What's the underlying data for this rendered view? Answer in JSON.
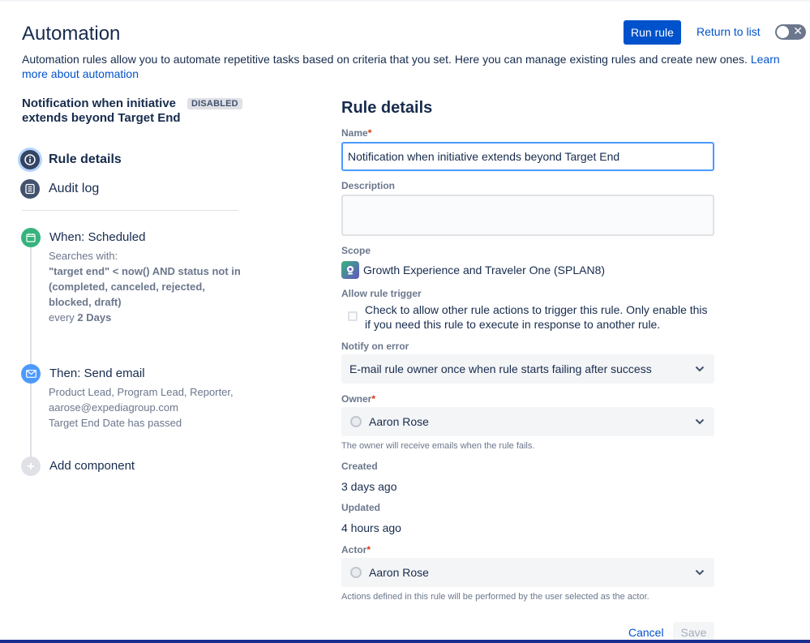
{
  "header": {
    "title": "Automation",
    "run_rule": "Run rule",
    "return_to_list": "Return to list",
    "intro_text": "Automation rules allow you to automate repetitive tasks based on criteria that you set. Here you can manage existing rules and create new ones. ",
    "learn_more": "Learn more about automation"
  },
  "sidebar": {
    "rule_name": "Notification when initiative extends beyond Target End",
    "status_badge": "DISABLED",
    "nav": [
      {
        "label": "Rule details",
        "icon": "info-icon",
        "active": true
      },
      {
        "label": "Audit log",
        "icon": "list-icon",
        "active": false
      }
    ],
    "trigger": {
      "title": "When: Scheduled",
      "searches_label": "Searches with:",
      "jql": "\"target end\" < now() AND status not in (completed, canceled, rejected, blocked, draft)",
      "every_prefix": "every ",
      "every_value": "2 Days",
      "color": "#36b37e"
    },
    "action": {
      "title": "Then: Send email",
      "recipients": "Product Lead, Program Lead, Reporter, aarose@expediagroup.com",
      "subject": "Target End Date has passed",
      "color": "#4c9aff"
    },
    "add_component": "Add component"
  },
  "details": {
    "title": "Rule details",
    "name_label": "Name",
    "name_value": "Notification when initiative extends beyond Target End",
    "description_label": "Description",
    "description_value": "",
    "scope_label": "Scope",
    "scope_value": "Growth Experience and Traveler One (SPLAN8)",
    "allow_trigger_label": "Allow rule trigger",
    "allow_trigger_text": "Check to allow other rule actions to trigger this rule. Only enable this if you need this rule to execute in response to another rule.",
    "notify_label": "Notify on error",
    "notify_value": "E-mail rule owner once when rule starts failing after success",
    "owner_label": "Owner",
    "owner_value": "Aaron Rose",
    "owner_help": "The owner will receive emails when the rule fails.",
    "created_label": "Created",
    "created_value": "3 days ago",
    "updated_label": "Updated",
    "updated_value": "4 hours ago",
    "actor_label": "Actor",
    "actor_value": "Aaron Rose",
    "actor_help": "Actions defined in this rule will be performed by the user selected as the actor.",
    "required_mark": "*",
    "cancel": "Cancel",
    "save": "Save"
  },
  "colors": {
    "primary": "#0052cc",
    "focus": "#4c9aff",
    "required": "#de350b"
  }
}
